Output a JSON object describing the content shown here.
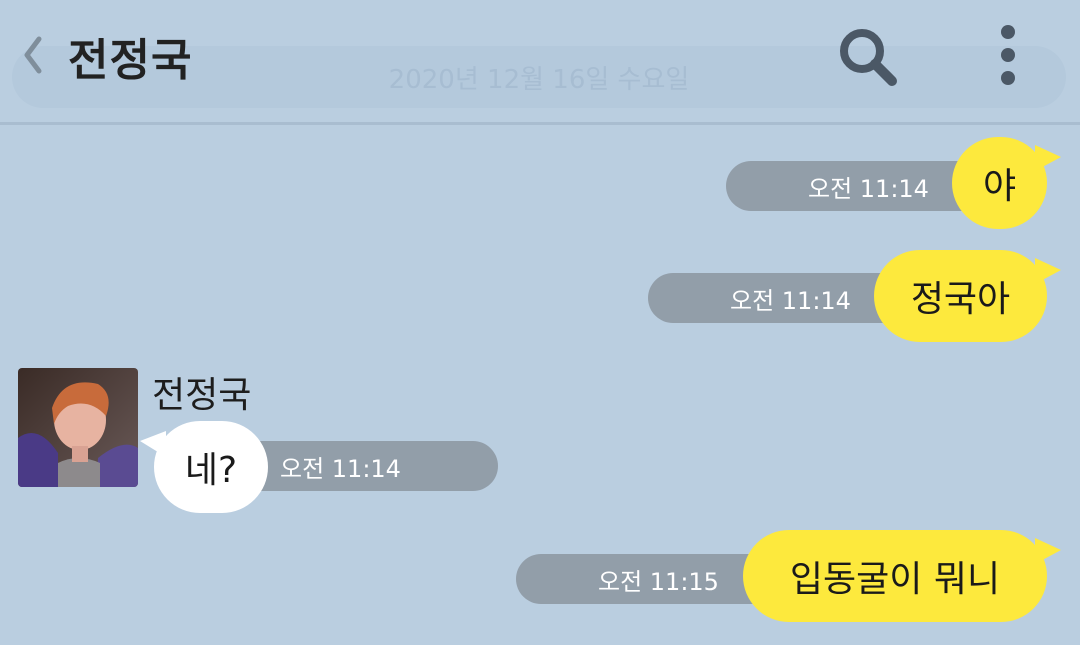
{
  "header": {
    "title": "전정국",
    "date": "2020년 12월 16일 수요일",
    "icons": {
      "back": "back-chevron-icon",
      "search": "search-icon",
      "more": "more-vertical-icon"
    }
  },
  "messages": [
    {
      "side": "me",
      "text": "야",
      "time": "오전 11:14"
    },
    {
      "side": "me",
      "text": "정국아",
      "time": "오전 11:14"
    },
    {
      "side": "other",
      "sender": "전정국",
      "text": "네?",
      "time": "오전 11:14"
    },
    {
      "side": "me",
      "text": "입동굴이 뭐니",
      "time": "오전 11:15"
    }
  ],
  "colors": {
    "background": "#bacee0",
    "my_bubble": "#fde93d",
    "other_bubble": "#ffffff",
    "time_pill": "#929ea9"
  }
}
